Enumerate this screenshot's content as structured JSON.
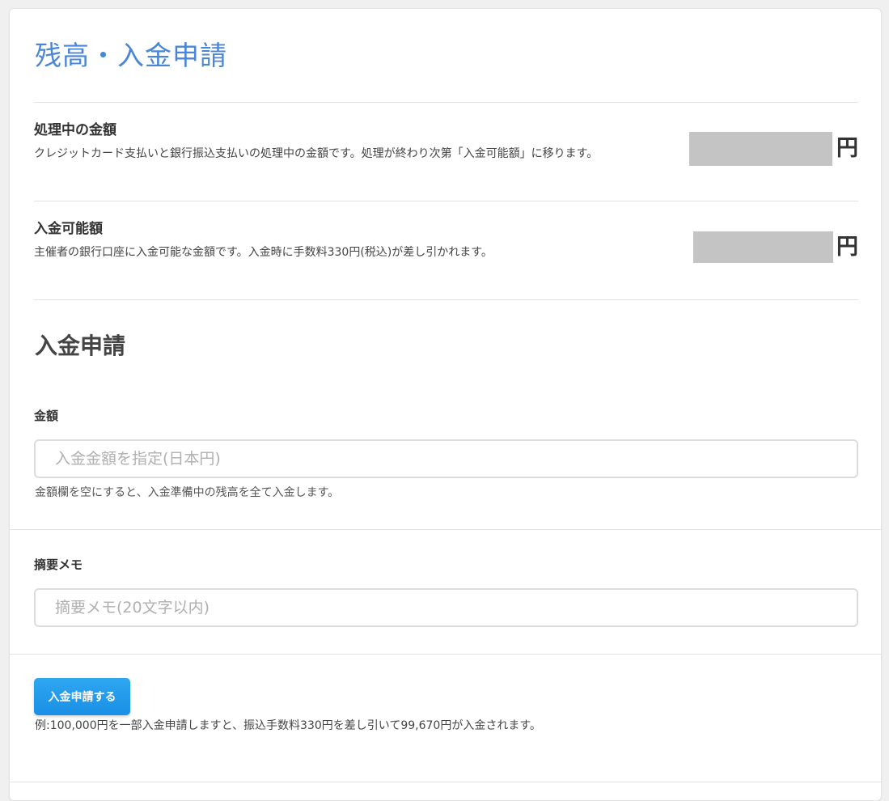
{
  "page": {
    "title": "残高・入金申請"
  },
  "balances": {
    "processing": {
      "label": "処理中の金額",
      "description": "クレジットカード支払いと銀行振込支払いの処理中の金額です。処理が終わり次第「入金可能額」に移ります。",
      "unit": "円"
    },
    "available": {
      "label": "入金可能額",
      "description": "主催者の銀行口座に入金可能な金額です。入金時に手数料330円(税込)が差し引かれます。",
      "unit": "円"
    }
  },
  "deposit_request": {
    "section_title": "入金申請",
    "amount": {
      "label": "金額",
      "value": "",
      "placeholder": "入金金額を指定(日本円)",
      "help": "金額欄を空にすると、入金準備中の残高を全て入金します。"
    },
    "memo": {
      "label": "摘要メモ",
      "value": "",
      "placeholder": "摘要メモ(20文字以内)"
    },
    "submit_label": "入金申請する",
    "example_note": "例:100,000円を一部入金申請しますと、振込手数料330円を差し引いて99,670円が入金されます。"
  },
  "colors": {
    "title": "#4a86d6",
    "button": "#1a8fe6",
    "masked_value": "#c4c4c4"
  }
}
